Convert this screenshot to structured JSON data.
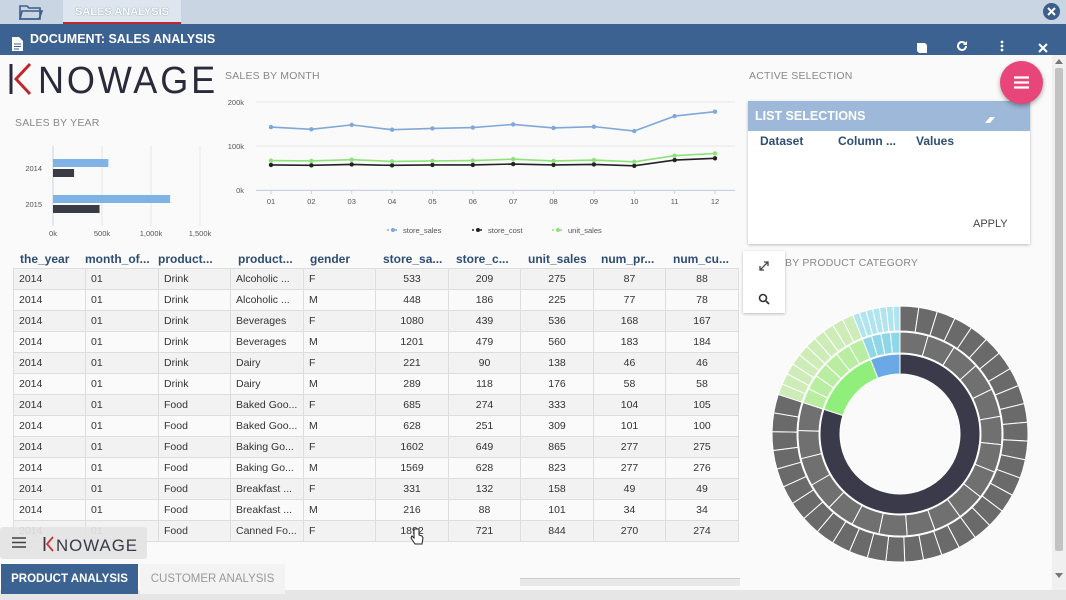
{
  "app": {
    "doc_tab": "SALES ANALYSIS",
    "title": "DOCUMENT: SALES ANALYSIS"
  },
  "brand": {
    "logo": "KNOWAGE",
    "accent": "#c0272d",
    "primary": "#3b6290",
    "fab": "#e8457a"
  },
  "widgets": {
    "sales_by_month": "SALES BY MONTH",
    "sales_by_year": "SALES BY YEAR",
    "active_selection": "ACTIVE SELECTION",
    "sunburst_title": "BY PRODUCT CATEGORY"
  },
  "selections": {
    "header": "LIST SELECTIONS",
    "columns": [
      "Dataset",
      "Column ...",
      "Values"
    ],
    "apply": "APPLY"
  },
  "table": {
    "columns": [
      "the_year",
      "month_of...",
      "product...",
      "product...",
      "gender",
      "store_sa...",
      "store_c...",
      "unit_sales",
      "num_pr...",
      "num_cu..."
    ],
    "rows": [
      [
        "2014",
        "01",
        "Drink",
        "Alcoholic ...",
        "F",
        "533",
        "209",
        "275",
        "87",
        "88"
      ],
      [
        "2014",
        "01",
        "Drink",
        "Alcoholic ...",
        "M",
        "448",
        "186",
        "225",
        "77",
        "78"
      ],
      [
        "2014",
        "01",
        "Drink",
        "Beverages",
        "F",
        "1080",
        "439",
        "536",
        "168",
        "167"
      ],
      [
        "2014",
        "01",
        "Drink",
        "Beverages",
        "M",
        "1201",
        "479",
        "560",
        "183",
        "184"
      ],
      [
        "2014",
        "01",
        "Drink",
        "Dairy",
        "F",
        "221",
        "90",
        "138",
        "46",
        "46"
      ],
      [
        "2014",
        "01",
        "Drink",
        "Dairy",
        "M",
        "289",
        "118",
        "176",
        "58",
        "58"
      ],
      [
        "2014",
        "01",
        "Food",
        "Baked Goo...",
        "F",
        "685",
        "274",
        "333",
        "104",
        "105"
      ],
      [
        "2014",
        "01",
        "Food",
        "Baked Goo...",
        "M",
        "628",
        "251",
        "309",
        "101",
        "100"
      ],
      [
        "2014",
        "01",
        "Food",
        "Baking Go...",
        "F",
        "1602",
        "649",
        "865",
        "277",
        "275"
      ],
      [
        "2014",
        "01",
        "Food",
        "Baking Go...",
        "M",
        "1569",
        "628",
        "823",
        "277",
        "276"
      ],
      [
        "2014",
        "01",
        "Food",
        "Breakfast ...",
        "F",
        "331",
        "132",
        "158",
        "49",
        "49"
      ],
      [
        "2014",
        "01",
        "Food",
        "Breakfast ...",
        "M",
        "216",
        "88",
        "101",
        "34",
        "34"
      ],
      [
        "2014",
        "01",
        "Food",
        "Canned Fo...",
        "F",
        "1892",
        "721",
        "844",
        "270",
        "274"
      ]
    ]
  },
  "sheet_tabs": [
    "PRODUCT ANALYSIS",
    "CUSTOMER ANALYSIS"
  ],
  "chart_data": [
    {
      "type": "line",
      "title": "SALES BY MONTH",
      "categories": [
        "01",
        "02",
        "03",
        "04",
        "05",
        "06",
        "07",
        "08",
        "09",
        "10",
        "11",
        "12"
      ],
      "ylim": [
        0,
        200000
      ],
      "yticks": [
        "0k",
        "100k",
        "200k"
      ],
      "series": [
        {
          "name": "store_sales",
          "color": "#7fa8d8",
          "values": [
            143000,
            138000,
            148000,
            137000,
            140000,
            142000,
            149000,
            141000,
            144000,
            134000,
            168000,
            178000
          ]
        },
        {
          "name": "store_cost",
          "color": "#222222",
          "values": [
            57000,
            56000,
            58000,
            56000,
            57000,
            57000,
            59000,
            57000,
            58000,
            55000,
            68000,
            72000
          ]
        },
        {
          "name": "unit_sales",
          "color": "#8de27a",
          "values": [
            67000,
            66000,
            69000,
            65000,
            66000,
            67000,
            70000,
            66000,
            68000,
            64000,
            78000,
            83000
          ]
        }
      ],
      "legend": "bottom"
    },
    {
      "type": "bar",
      "title": "SALES BY YEAR",
      "orientation": "horizontal",
      "categories": [
        "2014",
        "2015"
      ],
      "xticks": [
        "0k",
        "500k",
        "1,000k",
        "1,500k"
      ],
      "xlim": [
        0,
        1500000
      ],
      "series": [
        {
          "name": "store_sales",
          "color": "#7fb3e6",
          "values": [
            565000,
            1195000
          ]
        },
        {
          "name": "store_cost",
          "color": "#3b3b45",
          "values": [
            215000,
            475000
          ]
        }
      ]
    }
  ]
}
